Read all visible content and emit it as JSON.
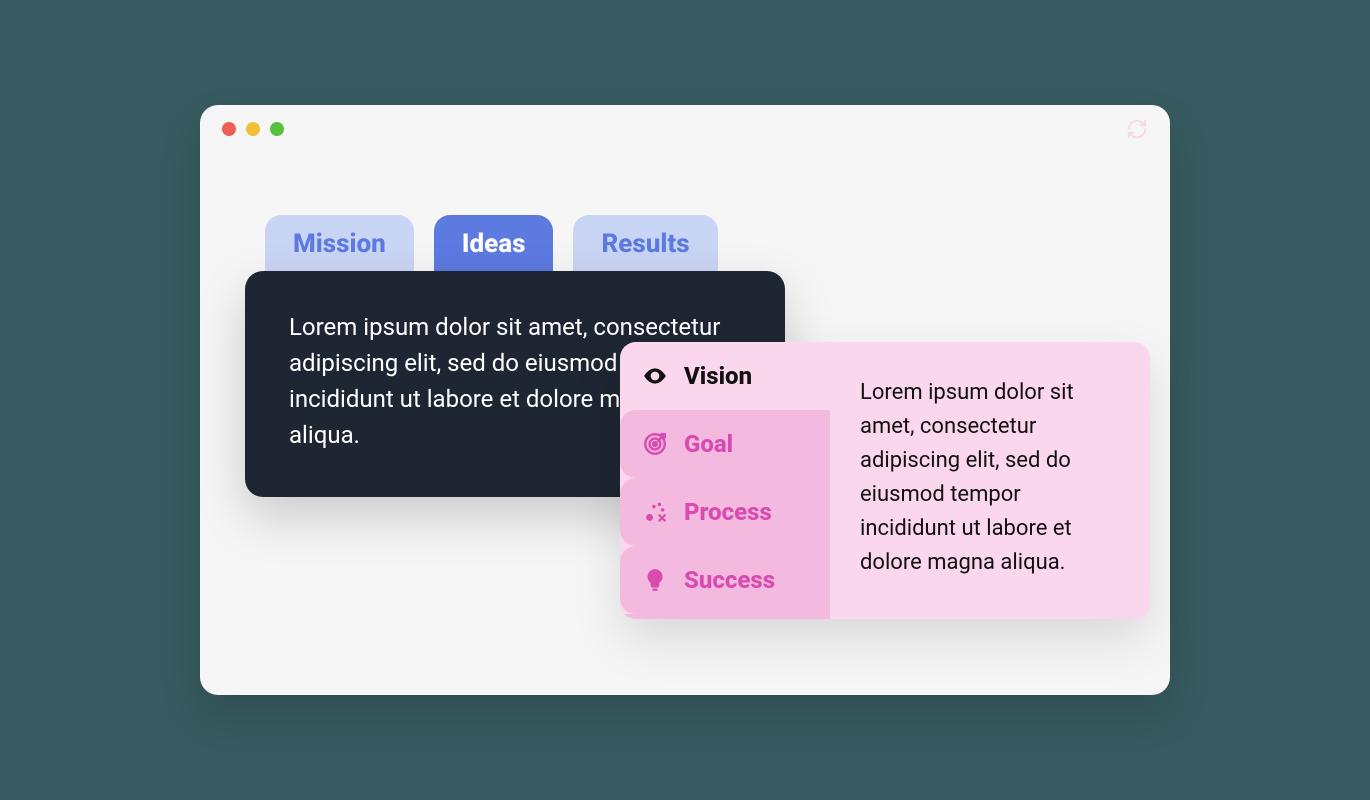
{
  "tabs": {
    "items": [
      {
        "label": "Mission"
      },
      {
        "label": "Ideas"
      },
      {
        "label": "Results"
      }
    ],
    "active_index": 1,
    "panel_text": "Lorem ipsum dolor sit amet, consectetur adipiscing elit, sed do eiusmod tempor incididunt ut labore et dolore magna aliqua."
  },
  "vlist": {
    "items": [
      {
        "label": "Vision",
        "icon": "eye-icon"
      },
      {
        "label": "Goal",
        "icon": "target-icon"
      },
      {
        "label": "Process",
        "icon": "strategy-icon"
      },
      {
        "label": "Success",
        "icon": "lightbulb-icon"
      }
    ],
    "active_index": 0,
    "panel_text": "Lorem ipsum dolor sit amet, consectetur adipiscing elit, sed do eiusmod tempor incididunt ut labore et dolore magna aliqua."
  },
  "colors": {
    "page_bg": "#375b60",
    "window_bg": "#f6f6f6",
    "tab_bg": "#c9d5f4",
    "tab_fg": "#5c7ae0",
    "tab_active_bg": "#5c7ae0",
    "tab_active_fg": "#ffffff",
    "tab_panel_bg": "#1e2633",
    "list_card_bg": "#fbd7ed",
    "list_item_bg": "#f3b9de",
    "list_accent": "#d94bb0"
  }
}
